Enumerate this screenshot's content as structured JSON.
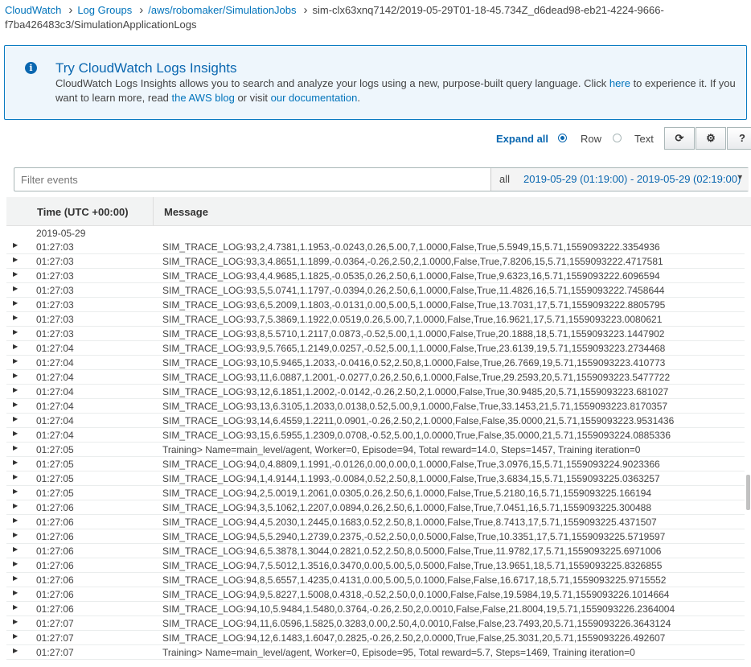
{
  "breadcrumb": {
    "items": [
      "CloudWatch",
      "Log Groups",
      "/aws/robomaker/SimulationJobs"
    ],
    "current": "sim-clx63xnq7142/2019-05-29T01-18-45.734Z_d6dead98-eb21-4224-9666-f7ba426483c3/SimulationApplicationLogs"
  },
  "insights": {
    "title": "Try CloudWatch Logs Insights",
    "text_before": "CloudWatch Logs Insights allows you to search and analyze your logs using a new, purpose-built query language. Click ",
    "link_here": "here",
    "text_mid": " to experience it. If you want to learn more, read ",
    "link_blog": "the AWS blog",
    "text_or": " or visit ",
    "link_docs": "our documentation",
    "text_end": "."
  },
  "toolbar": {
    "expand_all": "Expand all",
    "row_label": "Row",
    "text_label": "Text",
    "view_mode": "Row"
  },
  "filter": {
    "placeholder": "Filter events",
    "all_label": "all",
    "range": "2019-05-29 (01:19:00) - 2019-05-29 (02:19:00)"
  },
  "columns": {
    "time": "Time (UTC +00:00)",
    "message": "Message"
  },
  "date_label": "2019-05-29",
  "rows": [
    {
      "time": "01:27:03",
      "msg": "SIM_TRACE_LOG:93,2,4.7381,1.1953,-0.0243,0.26,5.00,7,1.0000,False,True,5.5949,15,5.71,1559093222.3354936"
    },
    {
      "time": "01:27:03",
      "msg": "SIM_TRACE_LOG:93,3,4.8651,1.1899,-0.0364,-0.26,2.50,2,1.0000,False,True,7.8206,15,5.71,1559093222.4717581"
    },
    {
      "time": "01:27:03",
      "msg": "SIM_TRACE_LOG:93,4,4.9685,1.1825,-0.0535,0.26,2.50,6,1.0000,False,True,9.6323,16,5.71,1559093222.6096594"
    },
    {
      "time": "01:27:03",
      "msg": "SIM_TRACE_LOG:93,5,5.0741,1.1797,-0.0394,0.26,2.50,6,1.0000,False,True,11.4826,16,5.71,1559093222.7458644"
    },
    {
      "time": "01:27:03",
      "msg": "SIM_TRACE_LOG:93,6,5.2009,1.1803,-0.0131,0.00,5.00,5,1.0000,False,True,13.7031,17,5.71,1559093222.8805795"
    },
    {
      "time": "01:27:03",
      "msg": "SIM_TRACE_LOG:93,7,5.3869,1.1922,0.0519,0.26,5.00,7,1.0000,False,True,16.9621,17,5.71,1559093223.0080621"
    },
    {
      "time": "01:27:03",
      "msg": "SIM_TRACE_LOG:93,8,5.5710,1.2117,0.0873,-0.52,5.00,1,1.0000,False,True,20.1888,18,5.71,1559093223.1447902"
    },
    {
      "time": "01:27:04",
      "msg": "SIM_TRACE_LOG:93,9,5.7665,1.2149,0.0257,-0.52,5.00,1,1.0000,False,True,23.6139,19,5.71,1559093223.2734468"
    },
    {
      "time": "01:27:04",
      "msg": "SIM_TRACE_LOG:93,10,5.9465,1.2033,-0.0416,0.52,2.50,8,1.0000,False,True,26.7669,19,5.71,1559093223.410773"
    },
    {
      "time": "01:27:04",
      "msg": "SIM_TRACE_LOG:93,11,6.0887,1.2001,-0.0277,0.26,2.50,6,1.0000,False,True,29.2593,20,5.71,1559093223.5477722"
    },
    {
      "time": "01:27:04",
      "msg": "SIM_TRACE_LOG:93,12,6.1851,1.2002,-0.0142,-0.26,2.50,2,1.0000,False,True,30.9485,20,5.71,1559093223.681027"
    },
    {
      "time": "01:27:04",
      "msg": "SIM_TRACE_LOG:93,13,6.3105,1.2033,0.0138,0.52,5.00,9,1.0000,False,True,33.1453,21,5.71,1559093223.8170357"
    },
    {
      "time": "01:27:04",
      "msg": "SIM_TRACE_LOG:93,14,6.4559,1.2211,0.0901,-0.26,2.50,2,1.0000,False,False,35.0000,21,5.71,1559093223.9531436"
    },
    {
      "time": "01:27:04",
      "msg": "SIM_TRACE_LOG:93,15,6.5955,1.2309,0.0708,-0.52,5.00,1,0.0000,True,False,35.0000,21,5.71,1559093224.0885336"
    },
    {
      "time": "01:27:05",
      "msg": "Training> Name=main_level/agent, Worker=0, Episode=94, Total reward=14.0, Steps=1457, Training iteration=0"
    },
    {
      "time": "01:27:05",
      "msg": "SIM_TRACE_LOG:94,0,4.8809,1.1991,-0.0126,0.00,0.00,0,1.0000,False,True,3.0976,15,5.71,1559093224.9023366"
    },
    {
      "time": "01:27:05",
      "msg": "SIM_TRACE_LOG:94,1,4.9144,1.1993,-0.0084,0.52,2.50,8,1.0000,False,True,3.6834,15,5.71,1559093225.0363257"
    },
    {
      "time": "01:27:05",
      "msg": "SIM_TRACE_LOG:94,2,5.0019,1.2061,0.0305,0.26,2.50,6,1.0000,False,True,5.2180,16,5.71,1559093225.166194"
    },
    {
      "time": "01:27:06",
      "msg": "SIM_TRACE_LOG:94,3,5.1062,1.2207,0.0894,0.26,2.50,6,1.0000,False,True,7.0451,16,5.71,1559093225.300488"
    },
    {
      "time": "01:27:06",
      "msg": "SIM_TRACE_LOG:94,4,5.2030,1.2445,0.1683,0.52,2.50,8,1.0000,False,True,8.7413,17,5.71,1559093225.4371507"
    },
    {
      "time": "01:27:06",
      "msg": "SIM_TRACE_LOG:94,5,5.2940,1.2739,0.2375,-0.52,2.50,0,0.5000,False,True,10.3351,17,5.71,1559093225.5719597"
    },
    {
      "time": "01:27:06",
      "msg": "SIM_TRACE_LOG:94,6,5.3878,1.3044,0.2821,0.52,2.50,8,0.5000,False,True,11.9782,17,5.71,1559093225.6971006"
    },
    {
      "time": "01:27:06",
      "msg": "SIM_TRACE_LOG:94,7,5.5012,1.3516,0.3470,0.00,5.00,5,0.5000,False,True,13.9651,18,5.71,1559093225.8326855"
    },
    {
      "time": "01:27:06",
      "msg": "SIM_TRACE_LOG:94,8,5.6557,1.4235,0.4131,0.00,5.00,5,0.1000,False,False,16.6717,18,5.71,1559093225.9715552"
    },
    {
      "time": "01:27:06",
      "msg": "SIM_TRACE_LOG:94,9,5.8227,1.5008,0.4318,-0.52,2.50,0,0.1000,False,False,19.5984,19,5.71,1559093226.1014664"
    },
    {
      "time": "01:27:06",
      "msg": "SIM_TRACE_LOG:94,10,5.9484,1.5480,0.3764,-0.26,2.50,2,0.0010,False,False,21.8004,19,5.71,1559093226.2364004"
    },
    {
      "time": "01:27:07",
      "msg": "SIM_TRACE_LOG:94,11,6.0596,1.5825,0.3283,0.00,2.50,4,0.0010,False,False,23.7493,20,5.71,1559093226.3643124"
    },
    {
      "time": "01:27:07",
      "msg": "SIM_TRACE_LOG:94,12,6.1483,1.6047,0.2825,-0.26,2.50,2,0.0000,True,False,25.3031,20,5.71,1559093226.492607"
    },
    {
      "time": "01:27:07",
      "msg": "Training> Name=main_level/agent, Worker=0, Episode=95, Total reward=5.7, Steps=1469, Training iteration=0"
    }
  ]
}
